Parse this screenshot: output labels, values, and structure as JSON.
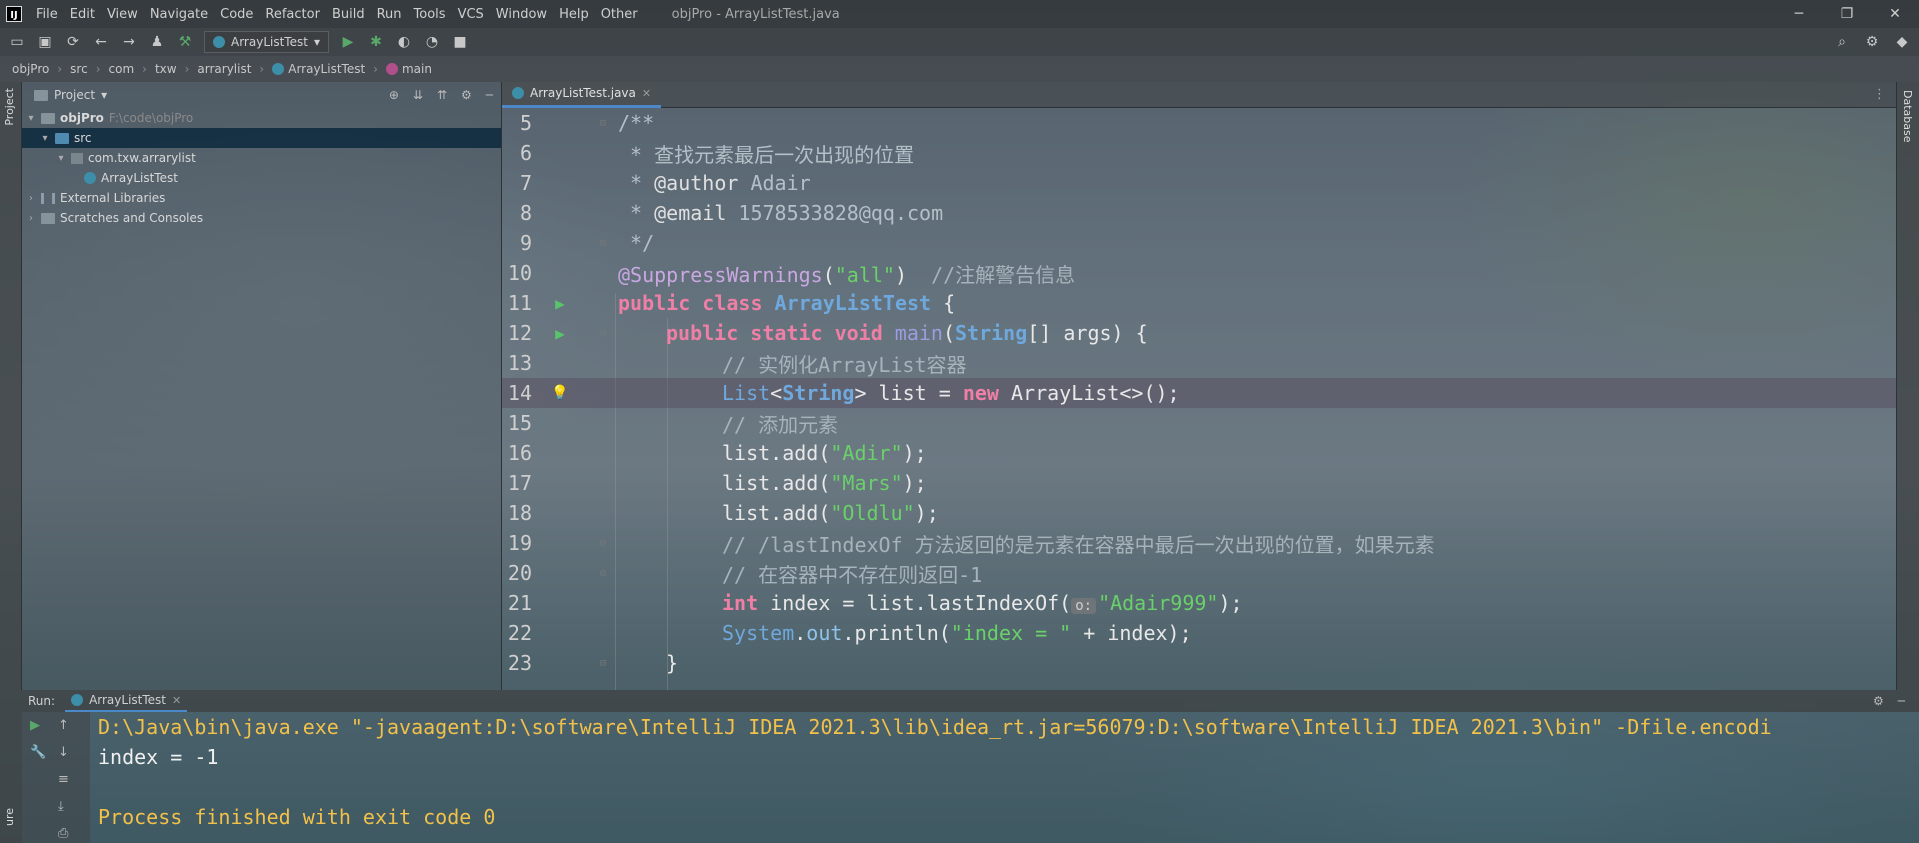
{
  "window": {
    "title": "objPro - ArrayListTest.java",
    "menu": [
      "File",
      "Edit",
      "View",
      "Navigate",
      "Code",
      "Refactor",
      "Build",
      "Run",
      "Tools",
      "VCS",
      "Window",
      "Help",
      "Other"
    ]
  },
  "toolbar": {
    "run_config": "ArrayListTest"
  },
  "breadcrumb": [
    "objPro",
    "src",
    "com",
    "txw",
    "arrarylist",
    "ArrayListTest",
    "main"
  ],
  "left_stripe": {
    "project_tab": "Project"
  },
  "project_panel": {
    "title": "Project",
    "tree": [
      {
        "label": "objPro",
        "path": "F:\\code\\objPro"
      },
      {
        "label": "src"
      },
      {
        "label": "com.txw.arrarylist"
      },
      {
        "label": "ArrayListTest"
      },
      {
        "label": "External Libraries"
      },
      {
        "label": "Scratches and Consoles"
      }
    ]
  },
  "editor": {
    "tab": "ArrayListTest.java",
    "line_numbers": [
      "5",
      "6",
      "7",
      "8",
      "9",
      "10",
      "11",
      "12",
      "13",
      "14",
      "15",
      "16",
      "17",
      "18",
      "19",
      "20",
      "21",
      "22",
      "23"
    ],
    "l5": "/**",
    "l6_star": " * ",
    "l6_text": "查找元素最后一次出现的位置",
    "l7_star": " * ",
    "l7_tag": "@author",
    "l7_val": " Adair",
    "l8_star": " * ",
    "l8_tag": "@email",
    "l8_val": " 1578533828@qq.com",
    "l9": " */",
    "l10_anno": "@SuppressWarnings",
    "l10_open": "(",
    "l10_str": "\"all\"",
    "l10_close": ")  ",
    "l10_cmt": "//注解警告信息",
    "l11_kw": "public class ",
    "l11_cls": "ArrayListTest",
    "l11_rest": " {",
    "l12_kw": "public static void ",
    "l12_fn": "main",
    "l12_open": "(",
    "l12_type": "String",
    "l12_rest": "[] args) {",
    "l13": "// 实例化ArrayList容器",
    "l14_type1": "List",
    "l14_lt": "<",
    "l14_type2": "String",
    "l14_mid": "> list = ",
    "l14_kw": "new ",
    "l14_rest": "ArrayList<>();",
    "l15": "// 添加元素",
    "l16_a": "list.add(",
    "l16_s": "\"Adir\"",
    "l16_b": ");",
    "l17_a": "list.add(",
    "l17_s": "\"Mars\"",
    "l17_b": ");",
    "l18_a": "list.add(",
    "l18_s": "\"Oldlu\"",
    "l18_b": ");",
    "l19": "// /lastIndexOf 方法返回的是元素在容器中最后一次出现的位置，如果元素",
    "l20": "// 在容器中不存在则返回-1",
    "l21_kw": "int ",
    "l21_a": "index = list.lastIndexOf(",
    "l21_hint": "o:",
    "l21_s": "\"Adair999\"",
    "l21_b": ");",
    "l22_type": "System",
    "l22_dot": ".",
    "l22_field": "out",
    "l22_a": ".println(",
    "l22_s": "\"index = \"",
    "l22_b": " + index);",
    "l23": "}"
  },
  "right_stripe": {
    "database_tab": "Database"
  },
  "run_panel": {
    "label": "Run:",
    "tab": "ArrayListTest",
    "side_label": "ure",
    "lines": [
      "D:\\Java\\bin\\java.exe \"-javaagent:D:\\software\\IntelliJ IDEA 2021.3\\lib\\idea_rt.jar=56079:D:\\software\\IntelliJ IDEA 2021.3\\bin\" -Dfile.encodi",
      "index = -1",
      "",
      "Process finished with exit code 0"
    ]
  },
  "colors": {
    "accent": "#4a88c7",
    "keyword": "#f07fa6",
    "string": "#6ad16a",
    "console_cmd": "#f2c14a"
  }
}
